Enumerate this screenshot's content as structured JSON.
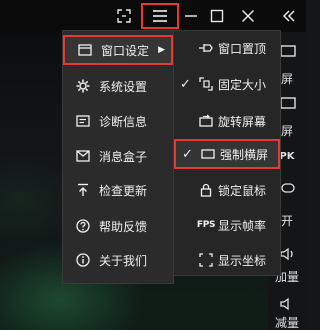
{
  "window_controls": {
    "fullscreen_icon": "crop-corners-icon",
    "menu_icon": "hamburger-menu-icon",
    "minimize_icon": "minimize-icon",
    "maximize_icon": "maximize-icon",
    "close_icon": "close-icon"
  },
  "main_menu": {
    "items": [
      {
        "label": "窗口设定",
        "icon": "window-icon",
        "has_submenu": true
      },
      {
        "label": "系统设置",
        "icon": "gear-icon"
      },
      {
        "label": "诊断信息",
        "icon": "document-icon"
      },
      {
        "label": "消息盒子",
        "icon": "mail-icon"
      },
      {
        "label": "检查更新",
        "icon": "upload-arrow-icon"
      },
      {
        "label": "帮助反馈",
        "icon": "help-icon"
      },
      {
        "label": "关于我们",
        "icon": "info-icon"
      }
    ]
  },
  "submenu": {
    "items": [
      {
        "label": "窗口置顶",
        "icon": "pin-icon",
        "checked": false
      },
      {
        "label": "固定大小",
        "icon": "fixed-size-icon",
        "checked": true
      },
      {
        "label": "旋转屏幕",
        "icon": "rotate-icon",
        "checked": false
      },
      {
        "label": "强制横屏",
        "icon": "landscape-icon",
        "checked": true
      },
      {
        "label": "锁定鼠标",
        "icon": "lock-icon",
        "checked": false
      },
      {
        "label": "显示帧率",
        "icon": "fps-icon",
        "icon_text": "FPS",
        "checked": false
      },
      {
        "label": "显示坐标",
        "icon": "coordinates-icon",
        "checked": false
      }
    ],
    "check_mark": "✓"
  },
  "side_toolbar": {
    "items": [
      {
        "label": "屏",
        "icon": "screen-icon"
      },
      {
        "label": "屏",
        "icon": "screen-icon"
      },
      {
        "label": "PK",
        "icon": "pk-icon"
      },
      {
        "label": "开",
        "icon": "toggle-icon"
      },
      {
        "label": "加量",
        "icon": "volume-up-icon"
      },
      {
        "label": "减量",
        "icon": "volume-down-icon"
      }
    ]
  },
  "colors": {
    "highlight_border": "#e53935",
    "menu_bg": "#2b2b2b",
    "text": "#f0f0f0"
  }
}
